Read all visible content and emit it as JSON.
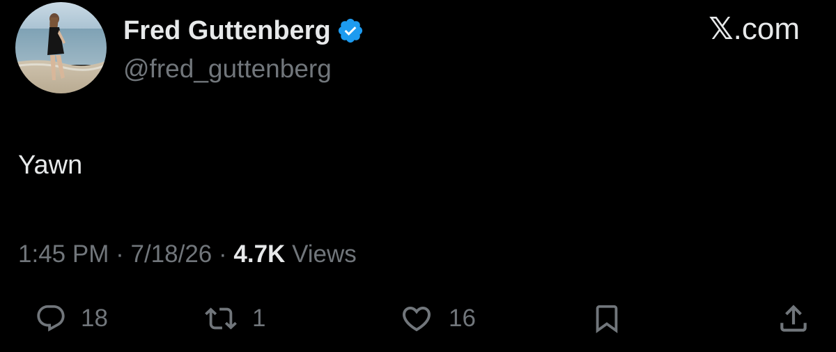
{
  "tweet": {
    "author": {
      "display_name": "Fred Guttenberg",
      "handle": "@fred_guttenberg",
      "verified": true,
      "verified_color": "#1d9bf0"
    },
    "watermark": {
      "mark": "𝕏",
      "suffix": ".com"
    },
    "text": "Yawn",
    "meta": {
      "time": "1:45 PM",
      "separator": "·",
      "date": "7/18/26",
      "views_count": "4.7K",
      "views_label": "Views"
    },
    "actions": {
      "replies": "18",
      "reposts": "1",
      "likes": "16"
    },
    "icons": {
      "reply": "reply-icon",
      "repost": "repost-icon",
      "like": "heart-icon",
      "bookmark": "bookmark-icon",
      "share": "share-icon"
    },
    "colors": {
      "background": "#000000",
      "text_primary": "#e7e9ea",
      "text_secondary": "#71767b"
    }
  }
}
